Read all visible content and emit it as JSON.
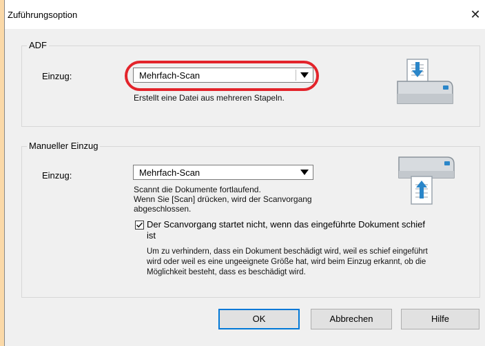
{
  "window": {
    "title": "Zuführungsoption",
    "close_label": "✕"
  },
  "adf": {
    "group_title": "ADF",
    "feed_label": "Einzug:",
    "selected": "Mehrfach-Scan",
    "description": "Erstellt eine Datei aus mehreren Stapeln."
  },
  "manual": {
    "group_title": "Manueller Einzug",
    "feed_label": "Einzug:",
    "selected": "Mehrfach-Scan",
    "desc_line1": "Scannt die Dokumente fortlaufend.",
    "desc_line2": "Wenn Sie [Scan] drücken, wird der Scanvorgang",
    "desc_line3": "abgeschlossen.",
    "checkbox_line1": "Der Scanvorgang startet nicht, wenn das eingeführte Dokument schief",
    "checkbox_line2": "ist",
    "checkbox_checked": true,
    "note_line1": "Um zu verhindern, dass ein Dokument beschädigt wird, weil es schief eingeführt",
    "note_line2": "wird oder weil es eine ungeeignete Größe hat, wird beim Einzug erkannt, ob die",
    "note_line3": "Möglichkeit besteht, dass es beschädigt wird."
  },
  "buttons": {
    "ok": "OK",
    "cancel": "Abbrechen",
    "help": "Hilfe"
  },
  "colors": {
    "highlight": "#e3242b",
    "default_button_border": "#0078d7",
    "page_background": "#fbd9a8"
  }
}
